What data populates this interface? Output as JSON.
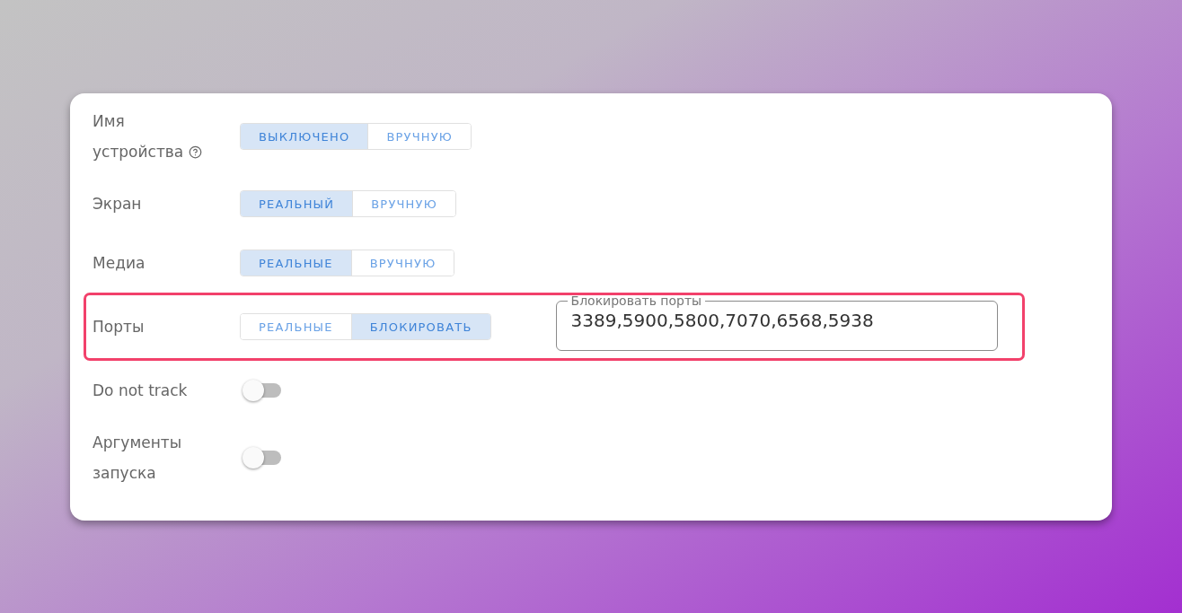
{
  "rows": [
    {
      "kind": "segmented",
      "label": "Имя устройства",
      "help": true,
      "highlighted": false,
      "options": [
        {
          "label": "ВЫКЛЮЧЕНО",
          "selected": true
        },
        {
          "label": "ВРУЧНУЮ",
          "selected": false
        }
      ]
    },
    {
      "kind": "segmented",
      "label": "Экран",
      "highlighted": false,
      "options": [
        {
          "label": "РЕАЛЬНЫЙ",
          "selected": true
        },
        {
          "label": "ВРУЧНУЮ",
          "selected": false
        }
      ]
    },
    {
      "kind": "segmented",
      "label": "Медиа",
      "highlighted": false,
      "options": [
        {
          "label": "РЕАЛЬНЫЕ",
          "selected": true
        },
        {
          "label": "ВРУЧНУЮ",
          "selected": false
        }
      ]
    },
    {
      "kind": "segmented",
      "label": "Порты",
      "highlighted": true,
      "options": [
        {
          "label": "РЕАЛЬНЫЕ",
          "selected": false
        },
        {
          "label": "БЛОКИРОВАТЬ",
          "selected": true
        }
      ],
      "field": {
        "label": "Блокировать порты",
        "value": "3389,5900,5800,7070,6568,5938"
      }
    },
    {
      "kind": "toggle",
      "label": "Do not track",
      "on": false
    },
    {
      "kind": "toggle",
      "label": "Аргументы запуска",
      "on": false
    }
  ]
}
